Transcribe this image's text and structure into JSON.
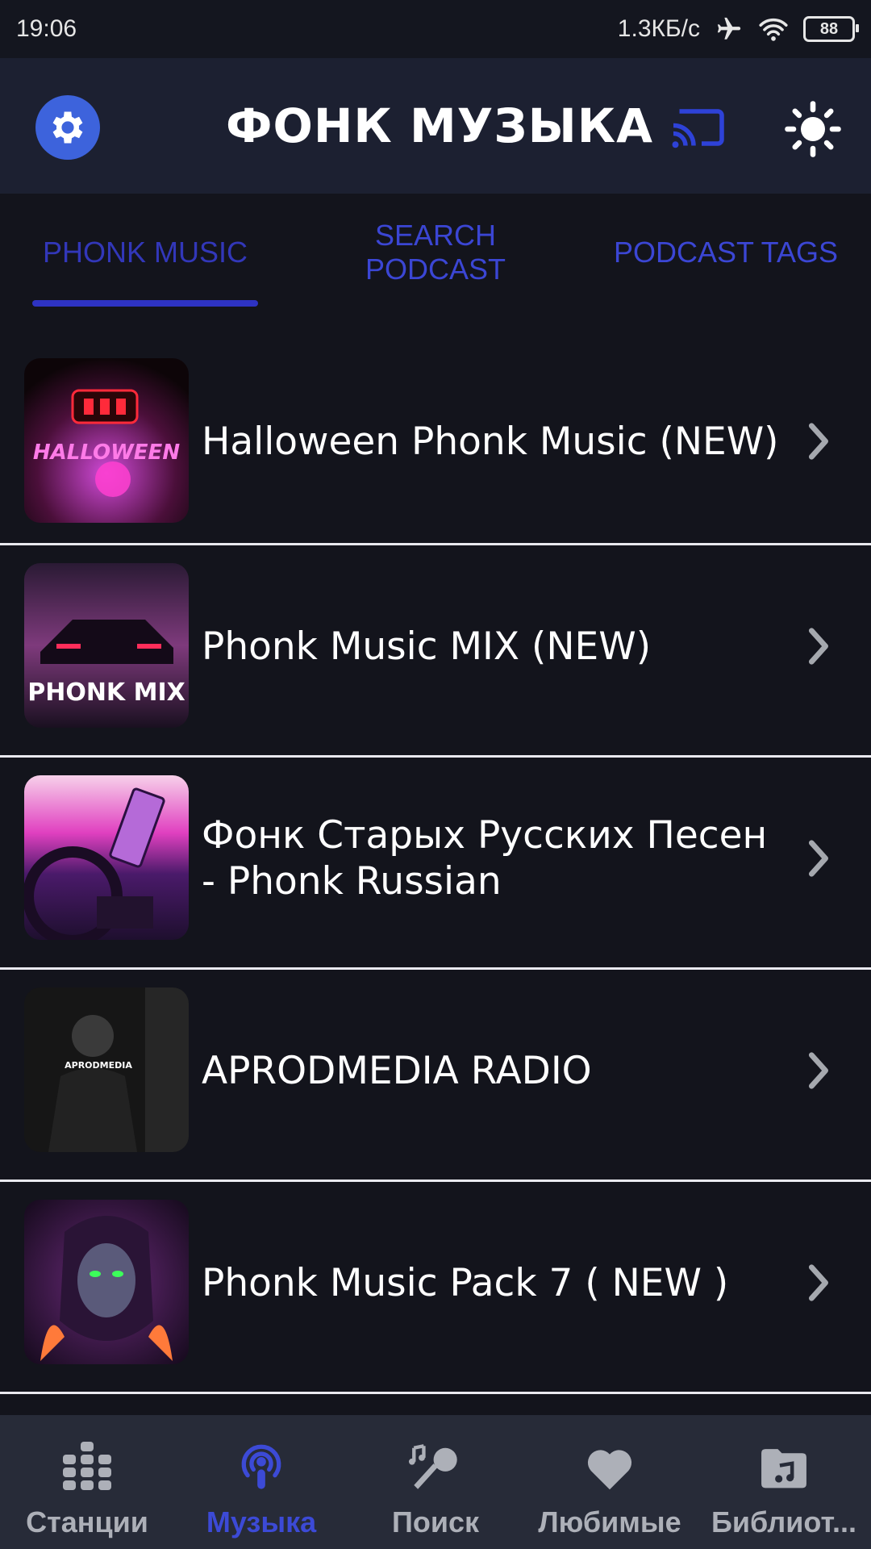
{
  "status_bar": {
    "time": "19:06",
    "network_speed": "1.3КБ/с",
    "battery": "88",
    "icons": [
      "airplane-icon",
      "wifi-icon",
      "battery-icon"
    ]
  },
  "header": {
    "title": "ФОНК МУЗЫКА",
    "icons": [
      "settings-icon",
      "cast-icon",
      "brightness-icon"
    ],
    "accent": "#3d63dc"
  },
  "tabs": [
    {
      "label": "PHONK MUSIC",
      "active": true
    },
    {
      "label": "SEARCH PODCAST",
      "active": false
    },
    {
      "label": "PODCAST TAGS",
      "active": false
    }
  ],
  "stations": [
    {
      "title": "Halloween Phonk Music (NEW)",
      "thumb_text": "HALLOWEEN"
    },
    {
      "title": "Phonk Music MIX (NEW)",
      "thumb_text": "PHONK MIX"
    },
    {
      "title": "Фонк Старых Русских Песен - Phonk Russian",
      "thumb_text": ""
    },
    {
      "title": "APRODMEDIA RADIO",
      "thumb_text": "APRODMEDIA"
    },
    {
      "title": "Phonk Music Pack 7 ( NEW )",
      "thumb_text": ""
    }
  ],
  "bottom_nav": [
    {
      "label": "Станции",
      "icon": "equalizer-icon",
      "active": false
    },
    {
      "label": "Музыка",
      "icon": "podcast-icon",
      "active": true
    },
    {
      "label": "Поиск",
      "icon": "microphone-icon",
      "active": false
    },
    {
      "label": "Любимые",
      "icon": "heart-icon",
      "active": false
    },
    {
      "label": "Библиот...",
      "icon": "music-folder-icon",
      "active": false
    }
  ],
  "colors": {
    "background": "#13141c",
    "appbar": "#1c2031",
    "tab_text": "#3b46d4",
    "nav_active": "#3c4ad6",
    "nav_inactive": "#adb0b8"
  }
}
